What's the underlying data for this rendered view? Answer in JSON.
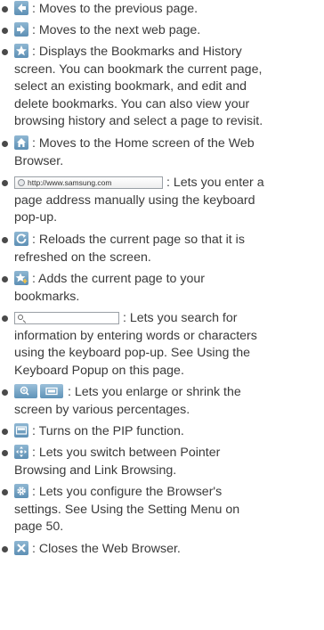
{
  "items": [
    {
      "icon": "back-arrow-icon",
      "lines": [
        ": Moves to the previous page."
      ]
    },
    {
      "icon": "forward-arrow-icon",
      "lines": [
        ": Moves to the next web page."
      ]
    },
    {
      "icon": "bookmark-star-icon",
      "lines": [
        ": Displays the Bookmarks and History",
        "screen. You can bookmark the current page,",
        "select an existing bookmark, and edit and",
        "delete bookmarks. You can also view your",
        "browsing history and select a page to revisit."
      ]
    },
    {
      "icon": "home-icon",
      "lines": [
        ": Moves to the Home screen of the Web",
        "Browser."
      ]
    },
    {
      "icon": "address-bar",
      "url": "http://www.samsung.com",
      "lines": [
        ": Lets you enter a",
        "page address manually using the keyboard",
        "pop-up."
      ]
    },
    {
      "icon": "reload-icon",
      "lines": [
        ": Reloads the current page so that it is",
        "refreshed on the screen."
      ]
    },
    {
      "icon": "add-bookmark-icon",
      "lines": [
        ": Adds the current page to your",
        "bookmarks."
      ]
    },
    {
      "icon": "search-bar",
      "lines": [
        ": Lets you search for",
        "information by entering words or characters",
        "using the keyboard pop-up. See Using the",
        "Keyboard Popup on this page."
      ]
    },
    {
      "icon": "zoom-icon",
      "lines": [
        ": Lets you enlarge or shrink the",
        "screen by various percentages."
      ]
    },
    {
      "icon": "pip-icon",
      "lines": [
        ": Turns on the PIP function."
      ]
    },
    {
      "icon": "pointer-link-icon",
      "lines": [
        ": Lets you switch between Pointer",
        "Browsing and Link Browsing."
      ]
    },
    {
      "icon": "settings-icon",
      "lines": [
        ": Lets you configure the Browser's",
        "settings. See Using the Setting Menu on",
        "page 50."
      ]
    },
    {
      "icon": "close-icon",
      "lines": [
        ": Closes the Web Browser."
      ]
    }
  ]
}
